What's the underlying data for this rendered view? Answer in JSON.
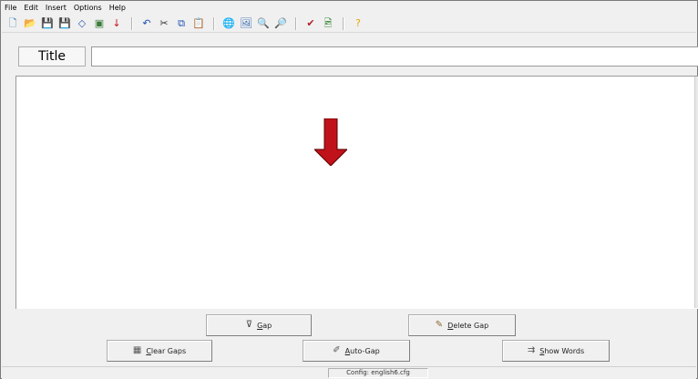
{
  "menu": [
    "File",
    "Edit",
    "Insert",
    "Options",
    "Help"
  ],
  "toolbar": {
    "groups": [
      [
        {
          "icon": "new-icon",
          "glyph": "🗋",
          "color": "#2a6fb5"
        },
        {
          "icon": "open-icon",
          "glyph": "📂",
          "color": "#d59a1e"
        },
        {
          "icon": "save-icon",
          "glyph": "💾",
          "color": "#1f3f8f"
        },
        {
          "icon": "save-as-icon",
          "glyph": "💾",
          "color": "#2c2c7a"
        },
        {
          "icon": "eraser-icon",
          "glyph": "◇",
          "color": "#2d5bb0"
        },
        {
          "icon": "export-icon",
          "glyph": "▣",
          "color": "#3a7c3a"
        },
        {
          "icon": "insert-down-icon",
          "glyph": "↓",
          "color": "#c11a1a"
        }
      ],
      [
        {
          "icon": "undo-icon",
          "glyph": "↶",
          "color": "#1f4fb5"
        },
        {
          "icon": "cut-icon",
          "glyph": "✂",
          "color": "#333333"
        },
        {
          "icon": "copy-icon",
          "glyph": "⧉",
          "color": "#1f4fb5"
        },
        {
          "icon": "paste-icon",
          "glyph": "📋",
          "color": "#7b5b2b"
        }
      ],
      [
        {
          "icon": "web-page-icon",
          "glyph": "🌐",
          "color": "#2b7a2b"
        },
        {
          "icon": "browser-icon",
          "glyph": "🖼",
          "color": "#2b62b0"
        },
        {
          "icon": "find-icon",
          "glyph": "🔍",
          "color": "#333333"
        },
        {
          "icon": "find-replace-icon",
          "glyph": "🔎",
          "color": "#333333"
        }
      ],
      [
        {
          "icon": "check-icon",
          "glyph": "✔",
          "color": "#b0222a"
        },
        {
          "icon": "picture-icon",
          "glyph": "🖻",
          "color": "#3a8a3a"
        }
      ],
      [
        {
          "icon": "help-icon",
          "glyph": "?",
          "color": "#e0a800"
        }
      ]
    ]
  },
  "title": {
    "label": "Title",
    "value": ""
  },
  "buttons": {
    "gap": "Gap",
    "delete_gap": "Delete Gap",
    "clear_gaps": "Clear Gaps",
    "auto_gap": "Auto-Gap",
    "show_words": "Show Words"
  },
  "status": {
    "config": "Config: english6.cfg"
  },
  "colors": {
    "arrow": "#c0121a"
  }
}
